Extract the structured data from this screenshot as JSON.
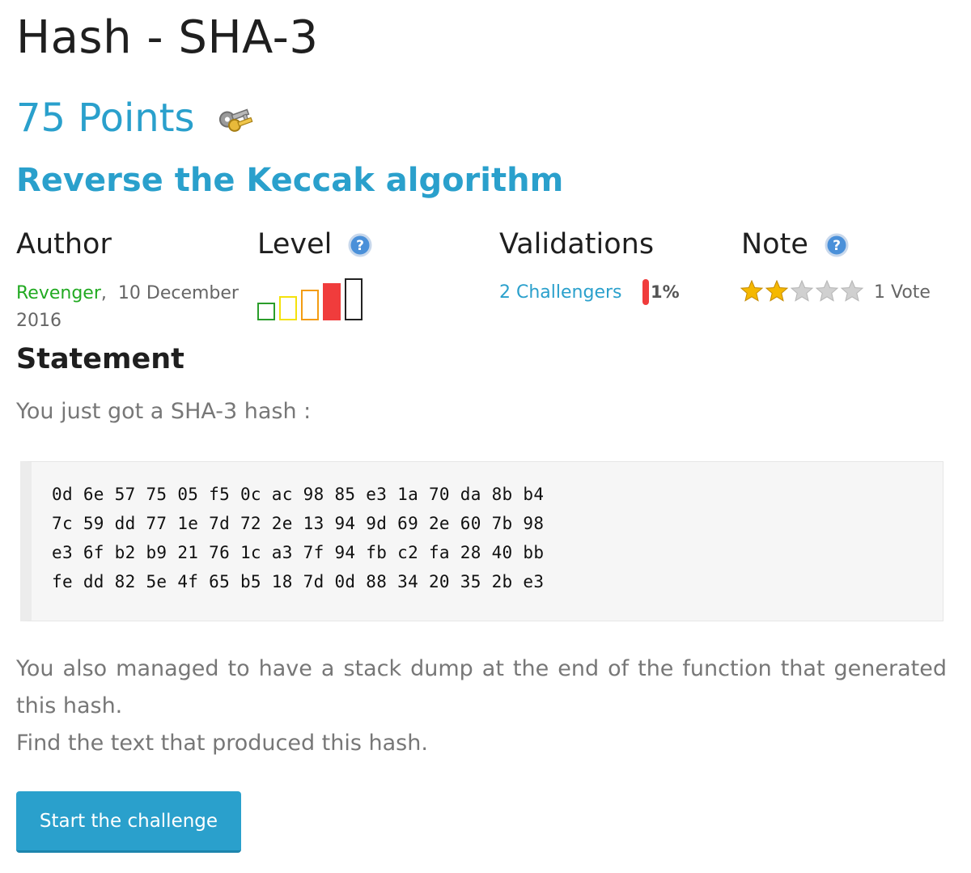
{
  "challenge": {
    "title": "Hash - SHA-3",
    "points": "75 Points",
    "subtitle": "Reverse the Keccak algorithm"
  },
  "meta": {
    "author_heading": "Author",
    "level_heading": "Level",
    "validations_heading": "Validations",
    "note_heading": "Note",
    "author_name": "Revenger",
    "author_separator": ",",
    "date": "10 December 2016",
    "challengers": "2 Challengers",
    "validation_percent": "1%",
    "validation_fraction": 0.01,
    "rating": 2,
    "rating_max": 5,
    "votes": "1 Vote",
    "level": 4,
    "level_max": 5,
    "level_colors": [
      "#2a9d2a",
      "#f4e20c",
      "#f39c12",
      "#f03c3c",
      "#222222"
    ]
  },
  "statement": {
    "heading": "Statement",
    "lead": "You just got a SHA-3 hash :",
    "hash_lines": [
      "0d 6e 57 75 05 f5 0c ac 98 85 e3 1a 70 da 8b b4",
      "7c 59 dd 77 1e 7d 72 2e 13 94 9d 69 2e 60 7b 98",
      "e3 6f b2 b9 21 76 1c a3 7f 94 fb c2 fa 28 40 bb",
      "fe dd 82 5e 4f 65 b5 18 7d 0d 88 34 20 35 2b e3"
    ],
    "paragraph1": "You also managed to have a stack dump at the end of the function that generated this hash.",
    "paragraph2": "Find the text that produced this hash."
  },
  "actions": {
    "start_label": "Start the challenge"
  },
  "colors": {
    "accent": "#2aa0cc",
    "author_link": "#22aa22",
    "star_filled": "#f5b800",
    "star_empty": "#d0d0d0"
  },
  "icons": {
    "points": "keys-icon",
    "help": "help-icon",
    "star": "star-icon"
  }
}
